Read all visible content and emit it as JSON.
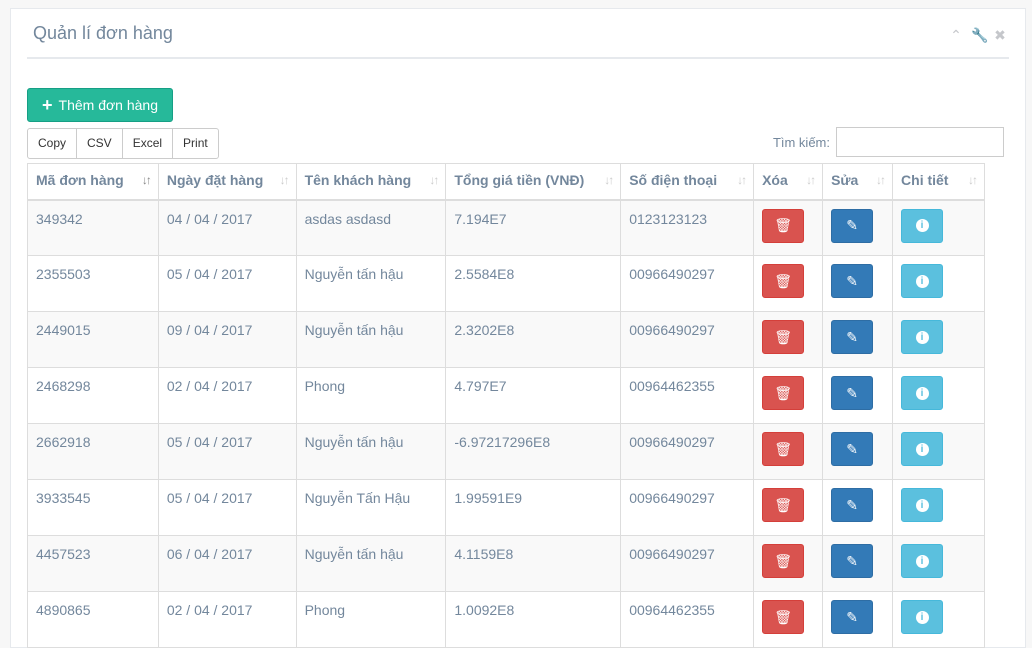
{
  "panel": {
    "title": "Quản lí đơn hàng"
  },
  "tools": {
    "collapse_icon": "chevron-up-icon",
    "wrench_icon": "wrench-icon",
    "close_icon": "close-icon"
  },
  "add_button": {
    "label": "Thêm đơn hàng"
  },
  "export_buttons": [
    "Copy",
    "CSV",
    "Excel",
    "Print"
  ],
  "search": {
    "label": "Tìm kiếm:",
    "value": ""
  },
  "table": {
    "columns": [
      "Mã đơn hàng",
      "Ngày đặt hàng",
      "Tên khách hàng",
      "Tổng giá tiền (VNĐ)",
      "Số điện thoại",
      "Xóa",
      "Sửa",
      "Chi tiết"
    ],
    "rows": [
      [
        "349342",
        "04 / 04 / 2017",
        "asdas asdasd",
        "7.194E7",
        "0123123123"
      ],
      [
        "2355503",
        "05 / 04 / 2017",
        "Nguyễn tấn hậu",
        "2.5584E8",
        "00966490297"
      ],
      [
        "2449015",
        "09 / 04 / 2017",
        "Nguyễn tấn hậu",
        "2.3202E8",
        "00966490297"
      ],
      [
        "2468298",
        "02 / 04 / 2017",
        "Phong",
        "4.797E7",
        "00964462355"
      ],
      [
        "2662918",
        "05 / 04 / 2017",
        "Nguyễn tấn hậu",
        "-6.97217296E8",
        "00966490297"
      ],
      [
        "3933545",
        "05 / 04 / 2017",
        "Nguyễn Tấn Hậu",
        "1.99591E9",
        "00966490297"
      ],
      [
        "4457523",
        "06 / 04 / 2017",
        "Nguyễn tấn hậu",
        "4.1159E8",
        "00966490297"
      ],
      [
        "4890865",
        "02 / 04 / 2017",
        "Phong",
        "1.0092E8",
        "00964462355"
      ]
    ]
  },
  "colors": {
    "add": "#26b99a",
    "delete": "#d9534f",
    "edit": "#337ab7",
    "info": "#5bc0de"
  }
}
